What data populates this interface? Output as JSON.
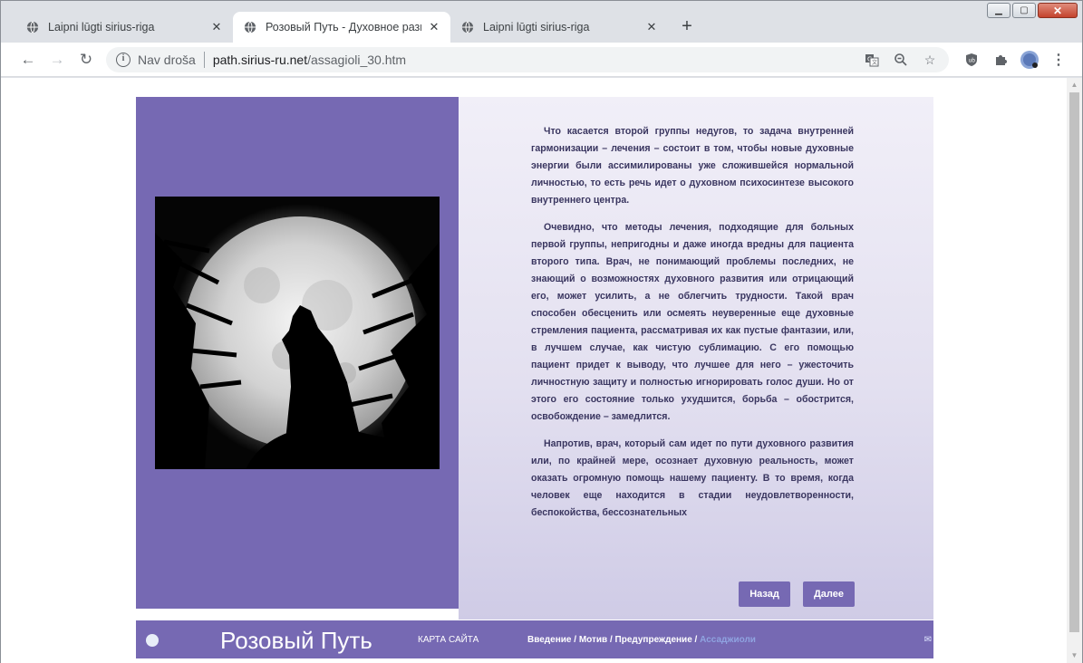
{
  "browser": {
    "tabs": [
      {
        "title": "Laipni lūgti sirius-riga",
        "active": false
      },
      {
        "title": "Розовый Путь - Духовное разви",
        "active": true
      },
      {
        "title": "Laipni lūgti sirius-riga",
        "active": false
      }
    ],
    "new_tab_label": "+",
    "address": {
      "security_label": "Nav droša",
      "host": "path.sirius-ru.net",
      "path": "/assagioli_30.htm"
    }
  },
  "article": {
    "paragraphs": [
      "Что касается второй группы недугов, то задача внутренней гармонизации – лечения – состоит в том, чтобы новые духовные энергии были ассимилированы уже сложившейся нормальной личностью, то есть речь идет о духовном психосинтезе высокого внутреннего центра.",
      "Очевидно, что методы лечения, подходящие для больных первой группы, непригодны и даже иногда вредны для пациента второго типа. Врач, не понимающий проблемы последних, не знающий о возможностях духовного развития или отрицающий его, может усилить, а не облегчить трудности. Такой врач способен обесценить или осмеять неуверенные еще духовные стремления пациента, рассматривая их как пустые фантазии, или, в лучшем случае, как чистую сублимацию. С его помощью пациент придет к выводу, что лучшее для него – ужесточить личностную защиту и полностью игнорировать голос души. Но от этого его состояние только ухудшится, борьба – обострится, освобождение – замедлится.",
      "Напротив, врач, который сам идет по пути духовного развития или, по крайней мере, осознает духовную реальность, может оказать огромную помощь нашему пациенту. В то время, когда человек еще находится в стадии неудовлетворенности, беспокойства, бессознательных"
    ]
  },
  "nav_buttons": {
    "back": "Назад",
    "next": "Далее"
  },
  "footer": {
    "brand": "Розовый Путь",
    "sitemap": "КАРТА САЙТА",
    "crumbs": [
      "Введение",
      "Мотив",
      "Предупреждение"
    ],
    "crumb_sep": " / ",
    "crumb_current": "Ассаджиоли"
  },
  "colors": {
    "accent": "#7669b3",
    "text": "#3a3660"
  }
}
